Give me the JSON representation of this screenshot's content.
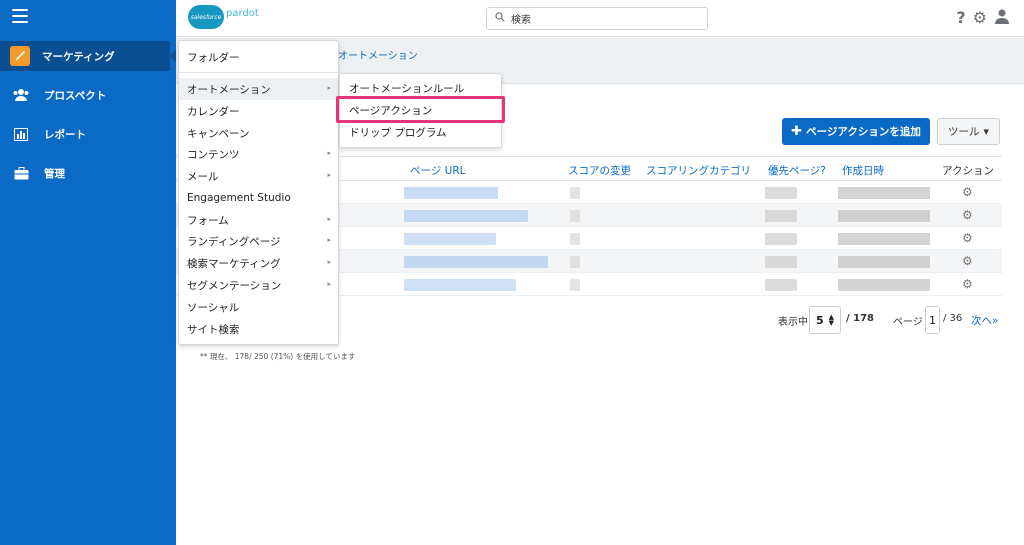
{
  "sidebar": {
    "items": [
      {
        "label": "マーケティング",
        "icon": "magic-wand-icon"
      },
      {
        "label": "プロスペクト",
        "icon": "people-icon"
      },
      {
        "label": "レポート",
        "icon": "bar-chart-icon"
      },
      {
        "label": "管理",
        "icon": "briefcase-icon"
      }
    ]
  },
  "header": {
    "brand": "salesforce",
    "product": "pardot",
    "search_text": "検索"
  },
  "breadcrumb": "オートメーション",
  "actions": {
    "add_label": "ページアクションを追加",
    "tools_label": "ツール"
  },
  "table": {
    "headers": [
      "ページ URL",
      "スコアの変更",
      "スコアリングカテゴリ",
      "優先ページ?",
      "作成日時",
      "アクション"
    ]
  },
  "pagination": {
    "showing_label": "表示中",
    "page_size": "5",
    "total": "/ 178",
    "page_label": "ページ",
    "current_page": "1",
    "total_pages": "/ 36",
    "next_label": "次へ»"
  },
  "footnote": "** 現在、 178/ 250 (71%) を使用しています",
  "menu": {
    "items": [
      "フォルダー",
      "オートメーション",
      "カレンダー",
      "キャンペーン",
      "コンテンツ",
      "メール",
      "Engagement Studio",
      "フォーム",
      "ランディングページ",
      "検索マーケティング",
      "セグメンテーション",
      "ソーシャル",
      "サイト検索"
    ]
  },
  "submenu": {
    "items": [
      "オートメーションルール",
      "ページアクション",
      "ドリップ プログラム"
    ]
  },
  "colors": {
    "sidebar": "#0a6ac5",
    "accent": "#0a6ac5",
    "highlight": "#e6337a",
    "marketing_icon": "#f39a2b"
  }
}
